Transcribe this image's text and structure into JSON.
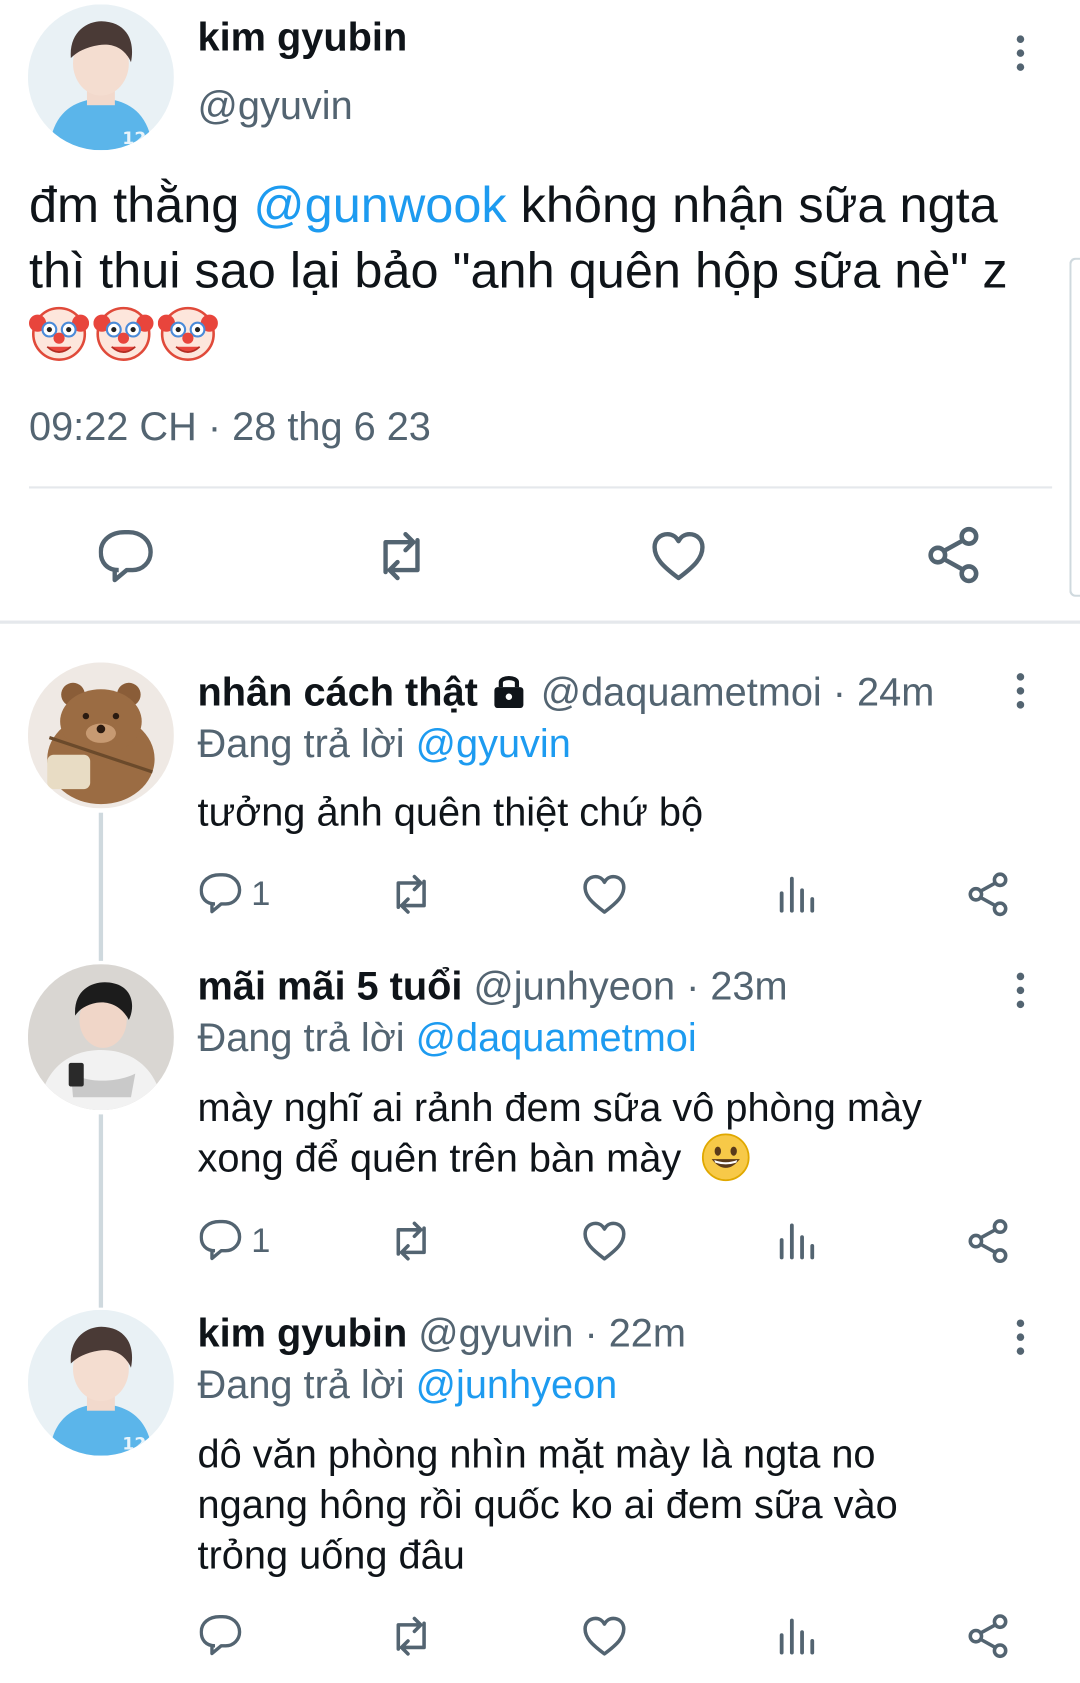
{
  "colors": {
    "accent": "#1d9bf0",
    "secondary": "#536471",
    "text": "#0f1419"
  },
  "main_tweet": {
    "display_name": "kim gyubin",
    "handle": "@gyuvin",
    "text_before": "đm thằng ",
    "mention": "@gunwook",
    "text_after": " không nhận sữa ngta thì thui sao lại bảo \"anh quên hộp sữa nè\" z ",
    "emoji_names": [
      "clown-face",
      "clown-face",
      "clown-face"
    ],
    "timestamp": "09:22 CH · 28 thg 6 23",
    "actions": [
      "reply-icon",
      "retweet-icon",
      "like-icon",
      "share-icon"
    ]
  },
  "replies": [
    {
      "display_name": "nhân cách thật",
      "lock_icon": "lock-icon",
      "handle": "@daquametmoi · 24m",
      "replying_prefix": "Đang trả lời ",
      "replying_to": "@gyuvin",
      "text": "tưởng ảnh quên thiệt chứ bộ",
      "reply_count": "1"
    },
    {
      "display_name": "mãi mãi 5 tuổi",
      "handle": "@junhyeon · 23m",
      "replying_prefix": "Đang trả lời ",
      "replying_to": "@daquametmoi",
      "text_line1": "mày nghĩ ai rảnh đem sữa vô phòng mày",
      "text_line2": "xong để quên trên bàn mày",
      "emoji": "grinning-face",
      "reply_count": "1"
    },
    {
      "display_name": "kim gyubin",
      "handle": "@gyuvin · 22m",
      "replying_prefix": "Đang trả lời ",
      "replying_to": "@junhyeon",
      "text_line1": "dô văn phòng nhìn mặt mày là ngta no",
      "text_line2": "ngang hông rồi quốc ko ai đem sữa vào",
      "text_line3": "trỏng uống đâu",
      "reply_count": ""
    }
  ]
}
